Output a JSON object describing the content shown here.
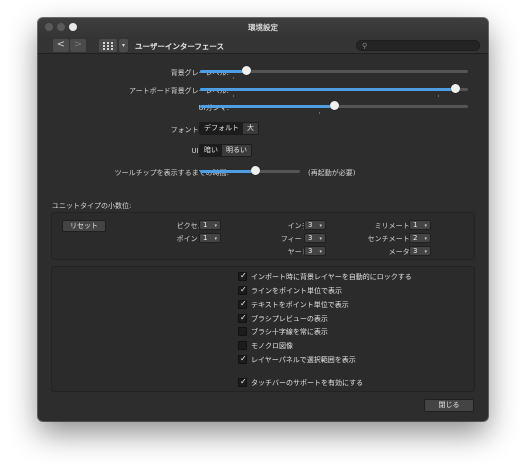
{
  "window": {
    "title": "環境設定"
  },
  "toolbar": {
    "back": "<",
    "forward": ">",
    "dropdown": "▾",
    "title": "ユーザーインターフェース",
    "search_placeholder": "",
    "search_icon": "⚲"
  },
  "sliders": [
    {
      "label": "背景グレーレベル:",
      "value": 0.17
    },
    {
      "label": "アートボード背景グレーレベル:",
      "value": 0.95
    },
    {
      "label": "UIガンマ:",
      "value": 0.5
    },
    {
      "label": "ツールチップを表示するまでの時間:",
      "value": 0.55,
      "note": "(再起動が必要)"
    }
  ],
  "font_size": {
    "label": "フォントUIサイズ:",
    "options": [
      "デフォルト",
      "大"
    ],
    "selected": 0
  },
  "ui_style": {
    "label": "UIスタイル:",
    "options": [
      "暗い",
      "明るい"
    ],
    "selected": 0
  },
  "units": {
    "title": "ユニットタイプの小数位:",
    "reset": "リセット",
    "rows": [
      {
        "label": "ピクセル:",
        "value": "1"
      },
      {
        "label": "ポイント:",
        "value": "1"
      },
      {
        "label": "インチ:",
        "value": "3"
      },
      {
        "label": "フィート:",
        "value": "3"
      },
      {
        "label": "ヤード:",
        "value": "3"
      },
      {
        "label": "ミリメートル:",
        "value": "1"
      },
      {
        "label": "センチメートル:",
        "value": "2"
      },
      {
        "label": "メーター:",
        "value": "3"
      }
    ]
  },
  "checkboxes": [
    {
      "label": "インポート時に背景レイヤーを自動的にロックする",
      "checked": true
    },
    {
      "label": "ラインをポイント単位で表示",
      "checked": true
    },
    {
      "label": "テキストをポイント単位で表示",
      "checked": true
    },
    {
      "label": "ブラシプレビューの表示",
      "checked": true
    },
    {
      "label": "ブラシ十字線を常に表示",
      "checked": false
    },
    {
      "label": "モノクロ図像",
      "checked": false
    },
    {
      "label": "レイヤーパネルで選択範囲を表示",
      "checked": true
    },
    {
      "label": "タッチバーのサポートを有効にする",
      "checked": true
    }
  ],
  "check_mark": "✓",
  "close": "閉じる",
  "colors": {
    "accent": "#4d9ee4",
    "window": "#2d2d2d"
  }
}
